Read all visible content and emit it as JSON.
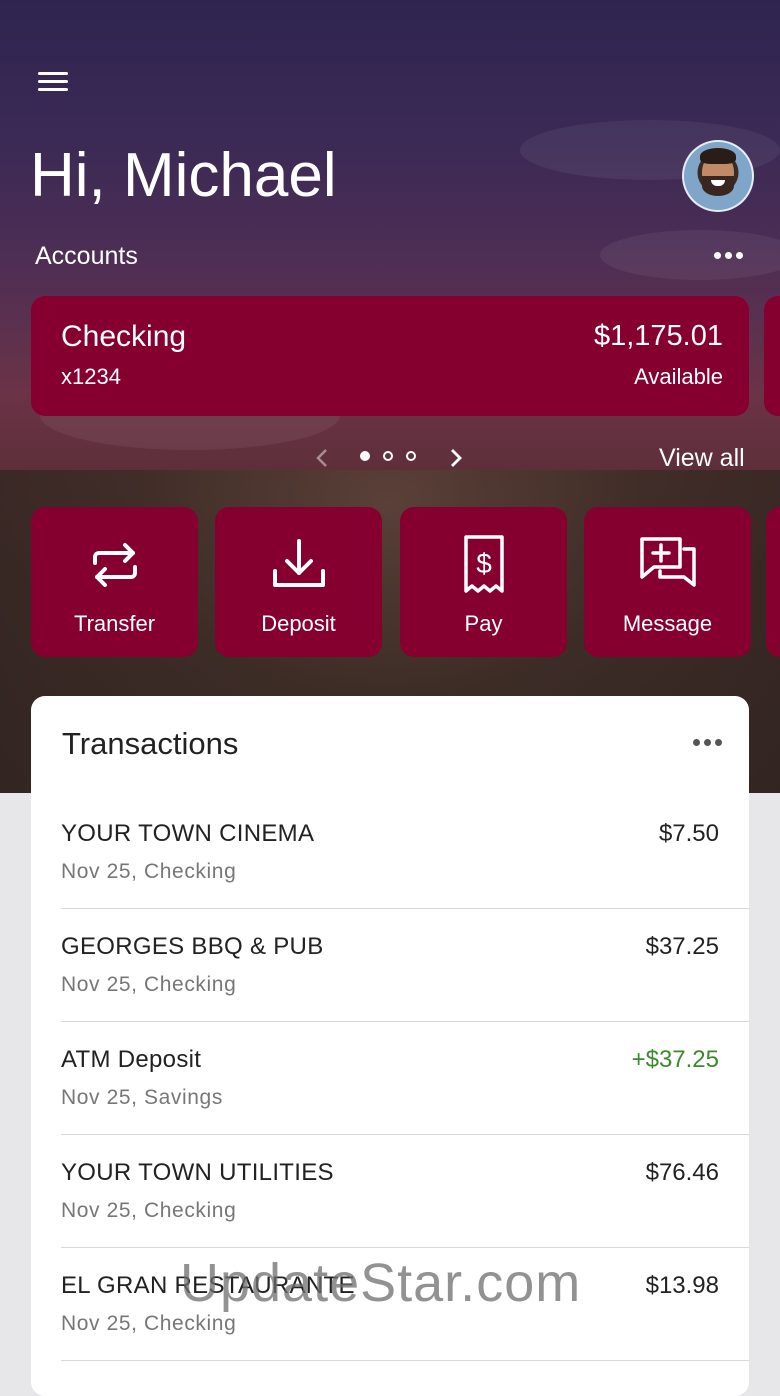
{
  "header": {
    "greeting": "Hi, Michael"
  },
  "accounts": {
    "label": "Accounts",
    "card": {
      "name": "Checking",
      "number": "x1234",
      "balance": "$1,175.01",
      "balance_label": "Available"
    },
    "pager": {
      "page": 1,
      "total": 3
    },
    "view_all": "View all"
  },
  "actions": [
    {
      "label": "Transfer",
      "icon": "transfer-icon"
    },
    {
      "label": "Deposit",
      "icon": "deposit-icon"
    },
    {
      "label": "Pay",
      "icon": "pay-icon"
    },
    {
      "label": "Message",
      "icon": "message-icon"
    }
  ],
  "transactions": {
    "title": "Transactions",
    "items": [
      {
        "name": "YOUR TOWN CINEMA",
        "sub": "Nov 25, Checking",
        "amount": "$7.50"
      },
      {
        "name": "GEORGES BBQ & PUB",
        "sub": "Nov 25, Checking",
        "amount": "$37.25"
      },
      {
        "name": "ATM Deposit",
        "sub": "Nov 25, Savings",
        "amount": "+$37.25"
      },
      {
        "name": "YOUR TOWN UTILITIES",
        "sub": "Nov 25, Checking",
        "amount": "$76.46"
      },
      {
        "name": "EL GRAN RESTAURANTE",
        "sub": "Nov 25, Checking",
        "amount": "$13.98"
      }
    ]
  },
  "colors": {
    "brand": "#85002f",
    "credit": "#3c8a2c"
  },
  "watermark": "UpdateStar.com"
}
